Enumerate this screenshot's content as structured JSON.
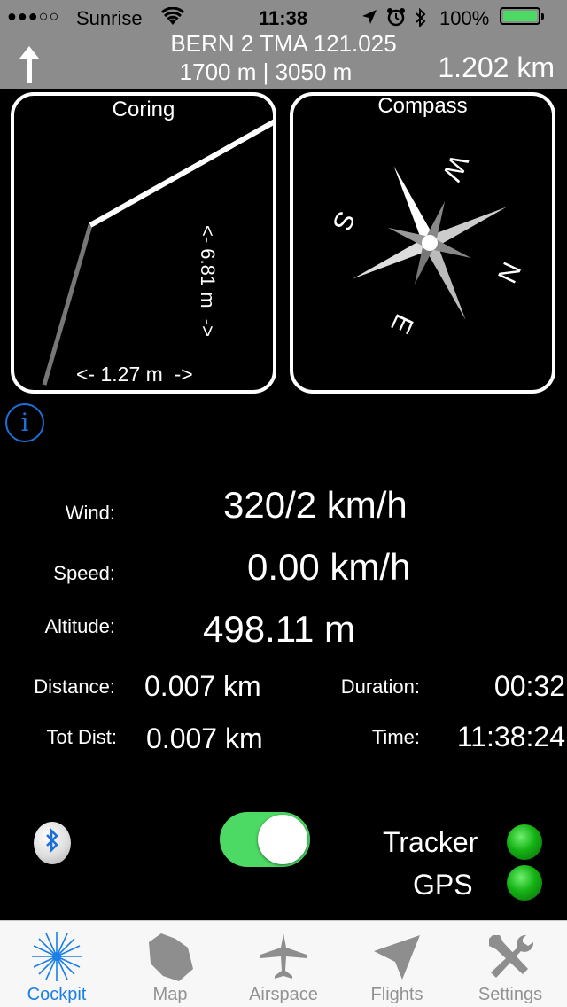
{
  "status_bar": {
    "signal": "●●●○○",
    "carrier": "Sunrise",
    "time": "11:38",
    "battery": "100%"
  },
  "airspace": {
    "name": "BERN 2 TMA 121.025",
    "altitudes": "1700 m | 3050 m",
    "distance": "1.202 km"
  },
  "coring": {
    "title": "Coring",
    "x_scale": "<- 1.27 m  ->",
    "y_scale": "<- 6.81 m  ->"
  },
  "compass": {
    "title": "Compass",
    "n": "N",
    "e": "E",
    "s": "S",
    "w": "W"
  },
  "stats": {
    "wind_label": "Wind:",
    "wind_value": "320/2 km/h",
    "speed_label": "Speed:",
    "speed_value": "0.00 km/h",
    "altitude_label": "Altitude:",
    "altitude_value": "498.11 m",
    "distance_label": "Distance:",
    "distance_value": "0.007 km",
    "duration_label": "Duration:",
    "duration_value": "00:32",
    "totdist_label": "Tot Dist:",
    "totdist_value": "0.007 km",
    "time_label": "Time:",
    "time_value": "11:38:24"
  },
  "controls": {
    "tracker_label": "Tracker",
    "gps_label": "GPS",
    "toggle_on": true
  },
  "tabs": [
    {
      "label": "Cockpit",
      "icon": "starburst-icon",
      "active": true
    },
    {
      "label": "Map",
      "icon": "map-icon",
      "active": false
    },
    {
      "label": "Airspace",
      "icon": "airplane-icon",
      "active": false
    },
    {
      "label": "Flights",
      "icon": "paper-plane-icon",
      "active": false
    },
    {
      "label": "Settings",
      "icon": "tools-icon",
      "active": false
    }
  ],
  "colors": {
    "header_gray": "#8c8c8c",
    "accent_blue": "#1a7fe6",
    "toggle_green": "#4cd964",
    "led_green": "#14b214"
  }
}
